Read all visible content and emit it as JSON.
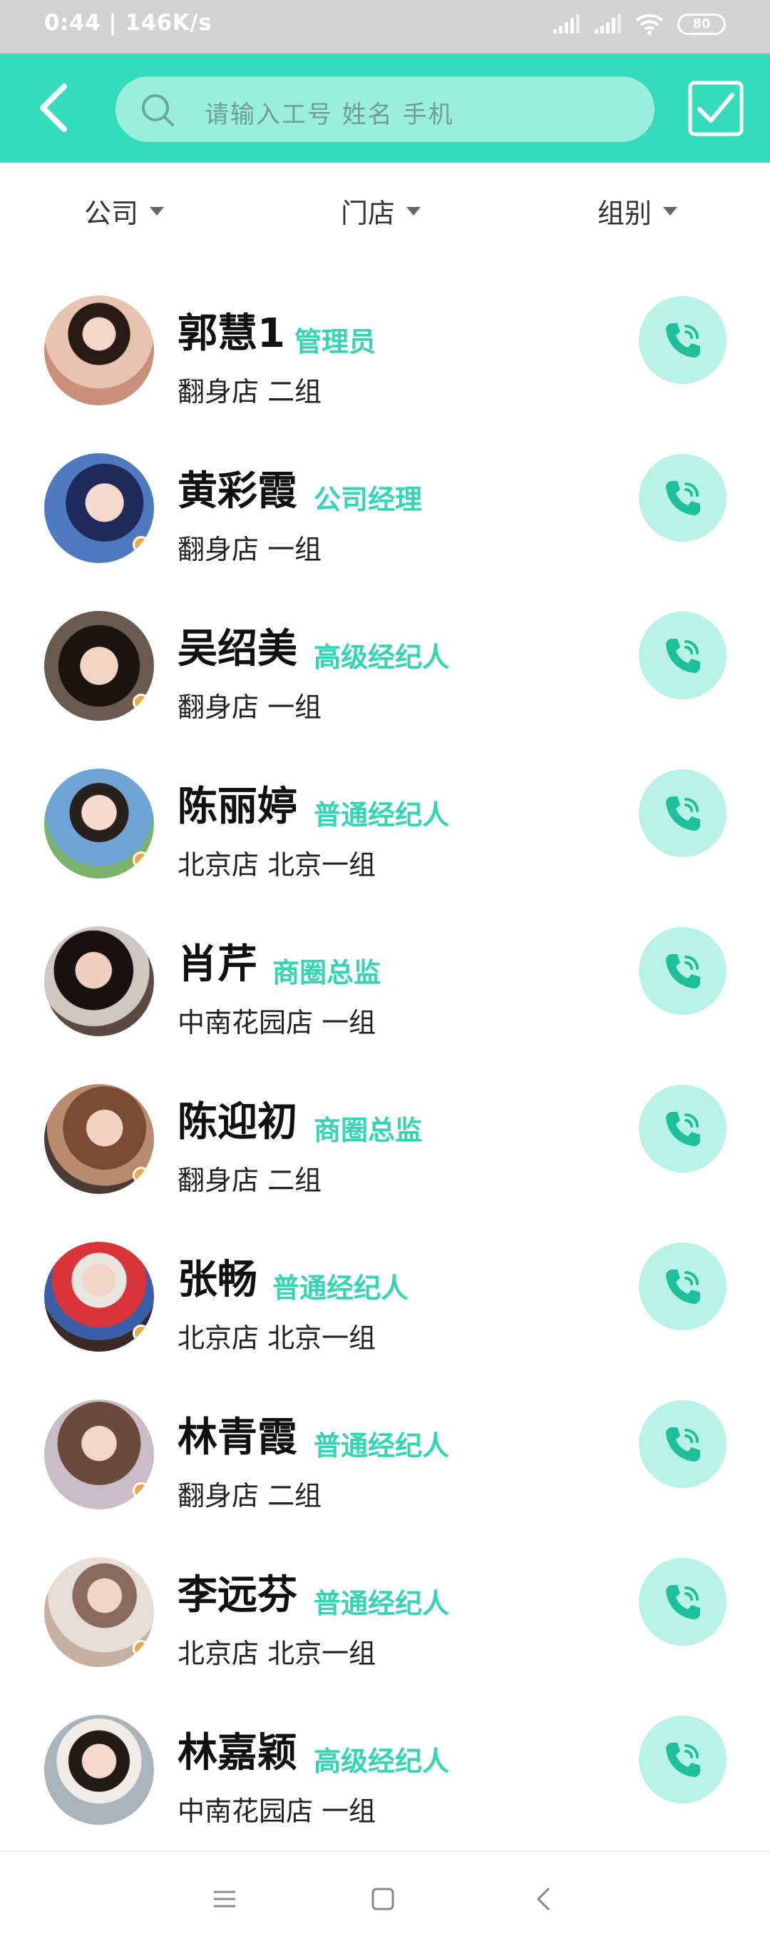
{
  "status_bar": {
    "time": "0:44 | 146K/s",
    "battery": "80"
  },
  "top_bar": {
    "back_icon": "chevron-left-icon",
    "search_icon": "search-icon",
    "search_placeholder": "请输入工号 姓名 手机",
    "confirm_icon": "checkbox-checked-icon",
    "background": "#34dcbc"
  },
  "filters": [
    {
      "label": "公司"
    },
    {
      "label": "门店"
    },
    {
      "label": "组别"
    }
  ],
  "contacts": [
    {
      "name": "郭慧1",
      "role": "管理员",
      "store": "翻身店 二组"
    },
    {
      "name": "黄彩霞",
      "role": "公司经理",
      "store": "翻身店 一组"
    },
    {
      "name": "吴绍美",
      "role": "高级经纪人",
      "store": "翻身店 一组"
    },
    {
      "name": "陈丽婷",
      "role": "普通经纪人",
      "store": "北京店 北京一组"
    },
    {
      "name": "肖芹",
      "role": "商圈总监",
      "store": "中南花园店 一组"
    },
    {
      "name": "陈迎初",
      "role": "商圈总监",
      "store": "翻身店 二组"
    },
    {
      "name": "张畅",
      "role": "普通经纪人",
      "store": "北京店 北京一组"
    },
    {
      "name": "林青霞",
      "role": "普通经纪人",
      "store": "翻身店 二组"
    },
    {
      "name": "李远芬",
      "role": "普通经纪人",
      "store": "北京店 北京一组"
    },
    {
      "name": "林嘉颖",
      "role": "高级经纪人",
      "store": "中南花园店 一组"
    }
  ],
  "nav_bar": {
    "menu_icon": "menu-icon",
    "home_icon": "home-square-icon",
    "back_icon": "back-triangle-icon"
  },
  "colors": {
    "accent": "#34dcbc",
    "role_text": "#34d4b4",
    "call_bg": "#b8f3e6"
  }
}
